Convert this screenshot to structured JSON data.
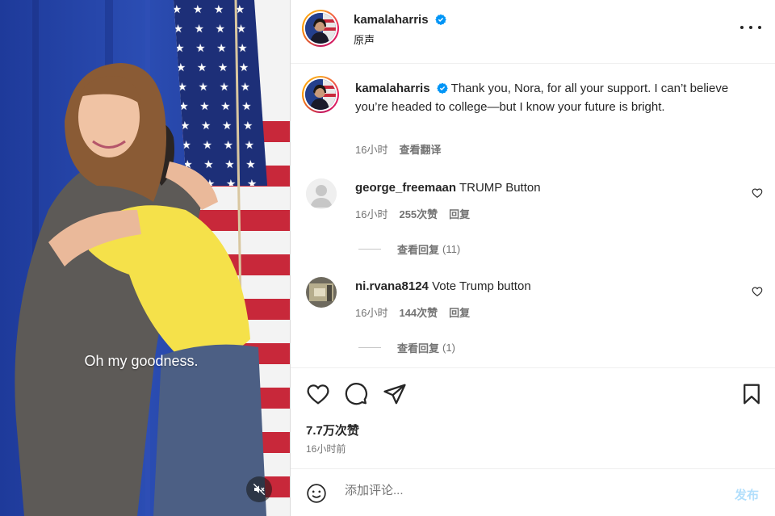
{
  "media": {
    "caption": "Oh my goodness.",
    "mute_icon": "speaker-muted-icon"
  },
  "post": {
    "username": "kamalaharris",
    "audio_label": "原声",
    "verified_icon": "verified-badge-icon",
    "more_icon": "more-options-icon"
  },
  "caption": {
    "username": "kamalaharris",
    "text": "Thank you, Nora, for all your support. I can’t believe you’re headed to college—but I know your future is bright.",
    "time": "16小时",
    "translate": "查看翻译"
  },
  "comments": [
    {
      "username": "george_freemaan",
      "text": "TRUMP Button",
      "time": "16小时",
      "likes": "255次赞",
      "reply": "回复",
      "view_replies": "查看回复",
      "reply_count": "(11)"
    },
    {
      "username": "ni.rvana8124",
      "text": "Vote Trump button",
      "time": "16小时",
      "likes": "144次赞",
      "reply": "回复",
      "view_replies": "查看回复",
      "reply_count": "(1)"
    }
  ],
  "actions": {
    "like_icon": "heart-icon",
    "comment_icon": "comment-bubble-icon",
    "share_icon": "paper-plane-icon",
    "save_icon": "bookmark-icon",
    "likes": "7.7万次赞",
    "time": "16小时前"
  },
  "composer": {
    "placeholder": "添加评论...",
    "post_label": "发布",
    "emoji_icon": "emoji-icon"
  },
  "colors": {
    "link_disabled": "#b2dffc",
    "verified": "#0095f6",
    "secondary_text": "#737373",
    "primary_text": "#262626"
  }
}
